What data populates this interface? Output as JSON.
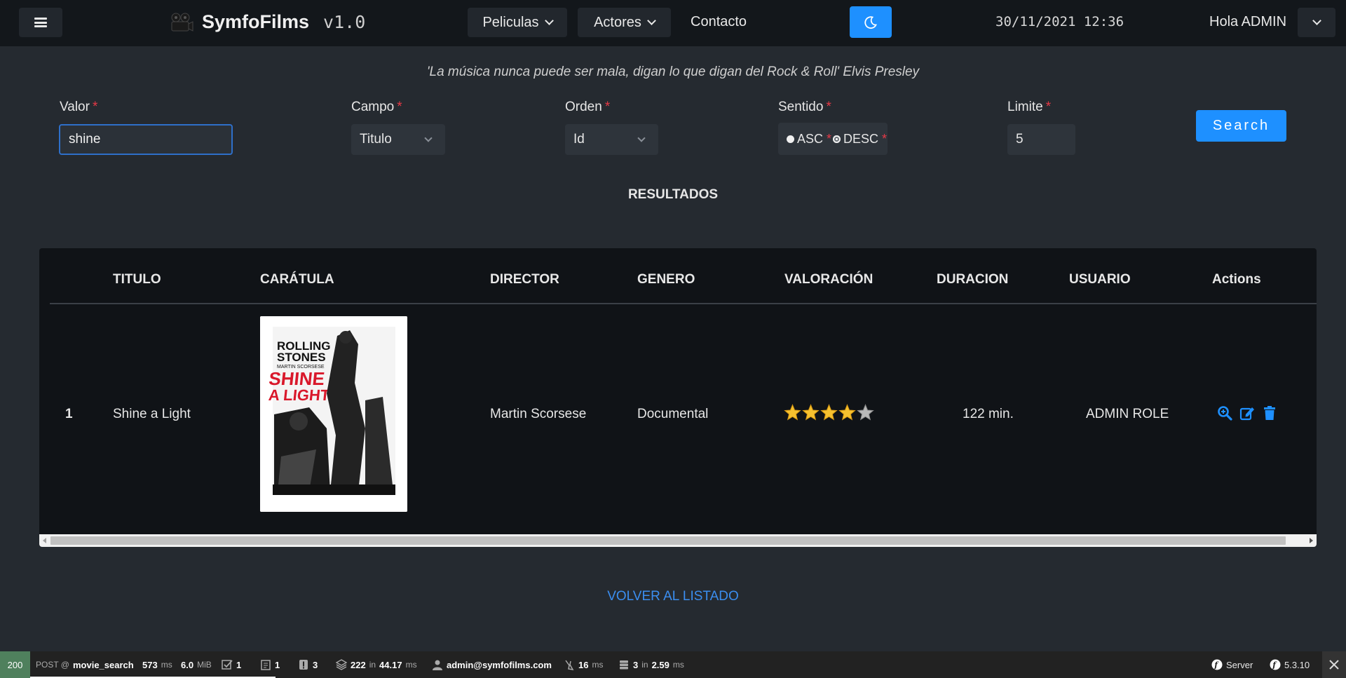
{
  "navbar": {
    "brand_name": "SymfoFilms",
    "brand_version": "v1.0",
    "menu_peliculas": "Peliculas",
    "menu_actores": "Actores",
    "menu_contacto": "Contacto",
    "datetime": "30/11/2021 12:36",
    "greeting": "Hola ADMIN",
    "accent_color": "#1e90ff"
  },
  "quote": "'La música nunca puede ser mala, digan lo que digan del Rock & Roll' Elvis Presley",
  "form": {
    "valor_label": "Valor",
    "valor_value": "shine",
    "campo_label": "Campo",
    "campo_value": "Titulo",
    "orden_label": "Orden",
    "orden_value": "Id",
    "sentido_label": "Sentido",
    "sentido_asc": "ASC",
    "sentido_desc": "DESC",
    "sentido_selected": "DESC",
    "limite_label": "Limite",
    "limite_value": "5",
    "required_mark": "*",
    "search_label": "Search"
  },
  "results_heading": "RESULTADOS",
  "table": {
    "headers": [
      "TITULO",
      "CARÁTULA",
      "DIRECTOR",
      "GENERO",
      "VALORACIÓN",
      "DURACION",
      "USUARIO",
      "Actions"
    ],
    "rows": [
      {
        "num": "1",
        "titulo": "Shine a Light",
        "caratula_text": [
          "ROLLING",
          "STONES",
          "MARTIN SCORSESE",
          "SHINE",
          "A LIGHT"
        ],
        "director": "Martin Scorsese",
        "genero": "Documental",
        "valoracion": 4,
        "valoracion_max": 5,
        "duracion": "122 min.",
        "usuario": "ADMIN ROLE"
      }
    ]
  },
  "back_link": "VOLVER AL LISTADO",
  "toolbar": {
    "status": "200",
    "method": "POST @",
    "route": "movie_search",
    "time": "573",
    "time_unit": "ms",
    "memory": "6.0",
    "memory_unit": "MiB",
    "forms": "1",
    "logs": "1",
    "warnings": "3",
    "twig_count": "222",
    "twig_in": "in",
    "twig_time": "44.17",
    "twig_unit": "ms",
    "user": "admin@symfofilms.com",
    "cache_time": "16",
    "cache_unit": "ms",
    "db_count": "3",
    "db_in": "in",
    "db_time": "2.59",
    "db_unit": "ms",
    "server": "Server",
    "symfony_version": "5.3.10"
  }
}
